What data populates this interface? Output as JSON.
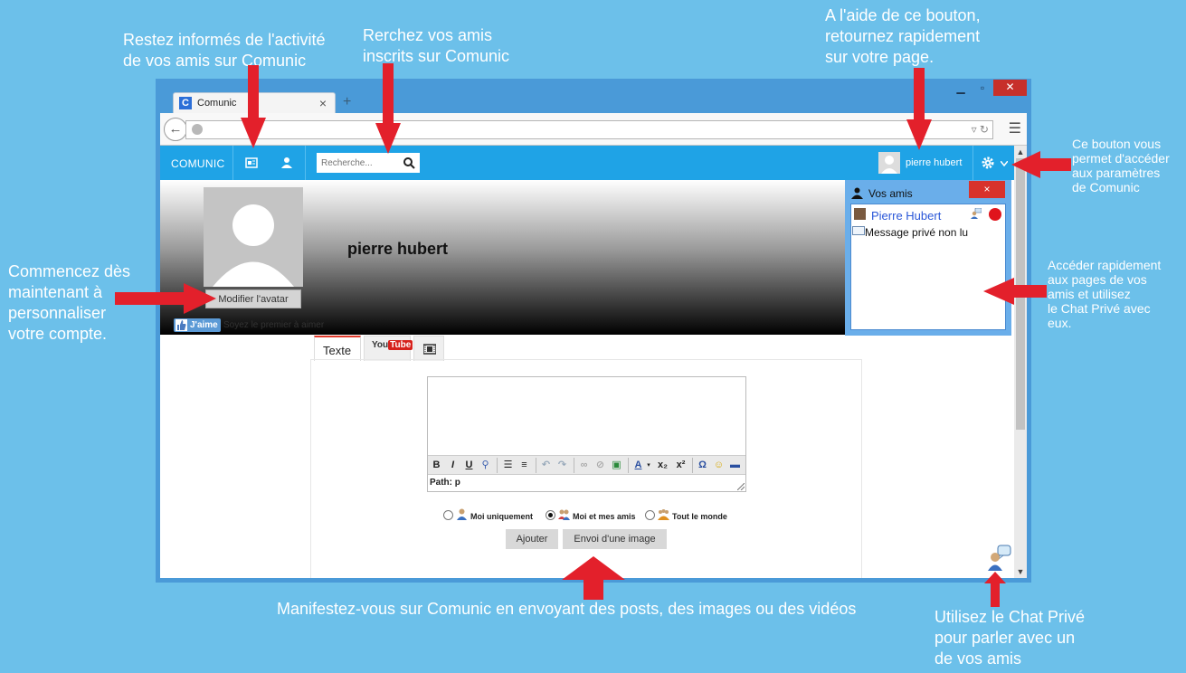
{
  "annotations": {
    "activity": "Restez informés de l'activité\nde vos amis sur Comunic",
    "search": "Rerchez vos amis\ninscrits sur Comunic",
    "home": "A l'aide de ce bouton,\nretournez rapidement\nsur votre page.",
    "settings": "Ce bouton vous\npermet d'accéder\naux paramètres\nde Comunic",
    "avatar": "Commencez dès\nmaintenant à\npersonnaliser\nvotre compte.",
    "friends": "Accéder rapidement\naux pages de vos\namis et utilisez\nle Chat Privé avec\neux.",
    "posts": "Manifestez-vous sur Comunic en envoyant des posts, des images ou des vidéos",
    "chat": "Utilisez le Chat Privé\npour parler avec un\nde vos amis"
  },
  "browser": {
    "tab_title": "Comunic",
    "tab_favicon": "C",
    "tab_close": "×",
    "new_tab": "+",
    "url": ""
  },
  "site": {
    "brand": "COMUNIC",
    "search_placeholder": "Recherche...",
    "user_name": "pierre hubert"
  },
  "profile": {
    "name": "pierre hubert",
    "avatar_button": "Modifier l'avatar",
    "like_button": "J'aime",
    "like_text": "Soyez le premier à aimer"
  },
  "friends_panel": {
    "title": "Vos amis",
    "close": "×",
    "friend_name": "Pierre Hubert",
    "private_message": "Message privé non lu"
  },
  "post": {
    "tabs": [
      {
        "label": "Texte"
      },
      {
        "label_you": "You",
        "label_tube": "Tube"
      },
      {
        "label": ""
      }
    ],
    "path": "Path: p",
    "visibility": [
      {
        "label": "Moi uniquement",
        "selected": false
      },
      {
        "label": "Moi et mes amis",
        "selected": true
      },
      {
        "label": "Tout le monde",
        "selected": false
      }
    ],
    "add_button": "Ajouter",
    "image_button": "Envoi d'une image"
  },
  "colors": {
    "background": "#6cc0ea",
    "arrow": "#e3202b",
    "site_nav": "#1fa3e6",
    "friends_panel": "#6aaeea",
    "friend_name": "#2a57d8",
    "status_offline": "#e0141c"
  }
}
